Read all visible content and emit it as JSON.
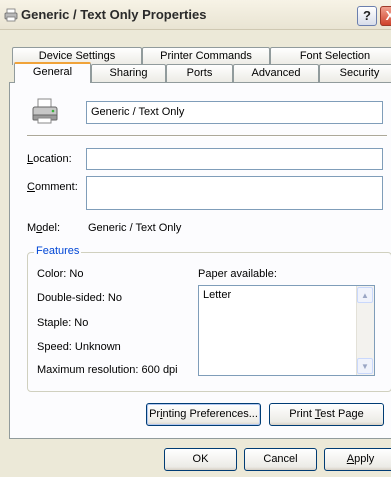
{
  "window": {
    "title": "Generic / Text Only Properties",
    "help_glyph": "?",
    "close_glyph": "X"
  },
  "tabs": {
    "row1": [
      "Device Settings",
      "Printer Commands",
      "Font Selection"
    ],
    "row2": [
      "General",
      "Sharing",
      "Ports",
      "Advanced",
      "Security"
    ],
    "active": "General"
  },
  "general": {
    "printer_name": "Generic / Text Only",
    "location": {
      "label": "Location:",
      "hotkey": "L",
      "rest": "ocation:",
      "value": ""
    },
    "comment": {
      "label": "Comment:",
      "hotkey": "C",
      "rest": "omment:",
      "value": ""
    },
    "model": {
      "label_pre": "M",
      "hotkey": "o",
      "label_post": "del:",
      "value": "Generic / Text Only"
    }
  },
  "features": {
    "title": "Features",
    "color": "Color: No",
    "double_sided": "Double-sided: No",
    "staple": "Staple: No",
    "speed": "Speed: Unknown",
    "max_resolution": "Maximum resolution: 600 dpi",
    "paper_available_label": "Paper available:",
    "paper_list": [
      "Letter"
    ]
  },
  "buttons": {
    "printing_preferences": {
      "pre": "Pr",
      "hotkey": "i",
      "post": "nting Preferences..."
    },
    "print_test_page": {
      "pre": "Print ",
      "hotkey": "T",
      "post": "est Page"
    },
    "ok": "OK",
    "cancel": "Cancel",
    "apply": {
      "hotkey": "A",
      "post": "pply"
    }
  },
  "colors": {
    "accent_tab": "#f0a33a",
    "group_title": "#0046d5",
    "dialog_bg": "#ece9d8"
  }
}
